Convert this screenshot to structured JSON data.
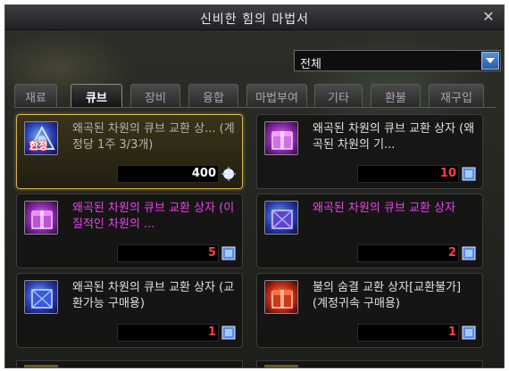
{
  "window": {
    "title": "신비한 힘의 마법서",
    "close_glyph": "✕"
  },
  "filter": {
    "value": "전체",
    "icon": "chevron-down-icon"
  },
  "tabs": [
    {
      "label": "재료",
      "active": false
    },
    {
      "label": "큐브",
      "active": true
    },
    {
      "label": "장비",
      "active": false
    },
    {
      "label": "융합",
      "active": false
    },
    {
      "label": "마법부여",
      "active": false
    },
    {
      "label": "기타",
      "active": false
    },
    {
      "label": "환불",
      "active": false
    },
    {
      "label": "재구입",
      "active": false
    }
  ],
  "items": [
    {
      "name": "왜곡된 차원의 큐브 교환 상... (계정당 1주 3/3개)",
      "price": "400",
      "tag": "한정",
      "currency_icon": "white-crystal-icon",
      "name_color": "#b4b4b4",
      "price_color": "#ffffff"
    },
    {
      "name": "왜곡된 차원의 큐브 교환 상자 (왜곡된 차원의 기...",
      "price": "10",
      "currency_icon": "blue-cube-icon",
      "name_color": "#e0e0e0",
      "price_color": "#ff4040"
    },
    {
      "name": "왜곡된 차원의 큐브 교환 상자 (이질적인 차원의 ...",
      "price": "5",
      "currency_icon": "blue-cube-icon",
      "name_color": "#f040f0",
      "price_color": "#ff4040"
    },
    {
      "name": "왜곡된 차원의 큐브 교환 상자",
      "price": "2",
      "currency_icon": "blue-cube-icon",
      "name_color": "#f040f0",
      "price_color": "#ff4040"
    },
    {
      "name": "왜곡된 차원의 큐브 교환 상자 (교환가능 구매용)",
      "price": "1",
      "currency_icon": "blue-cube-icon",
      "name_color": "#e0e0e0",
      "price_color": "#ff4040"
    },
    {
      "name": "불의 숨결 교환 상자[교환불가] (계정귀속 구매용)",
      "price": "1",
      "currency_icon": "blue-cube-icon",
      "name_color": "#e0e0e0",
      "price_color": "#ff4040"
    }
  ],
  "colors": {
    "selected_border": "#d4b24a",
    "magenta_text": "#f040f0",
    "price_red": "#ff4040",
    "accent_blue": "#3a6ac0"
  }
}
